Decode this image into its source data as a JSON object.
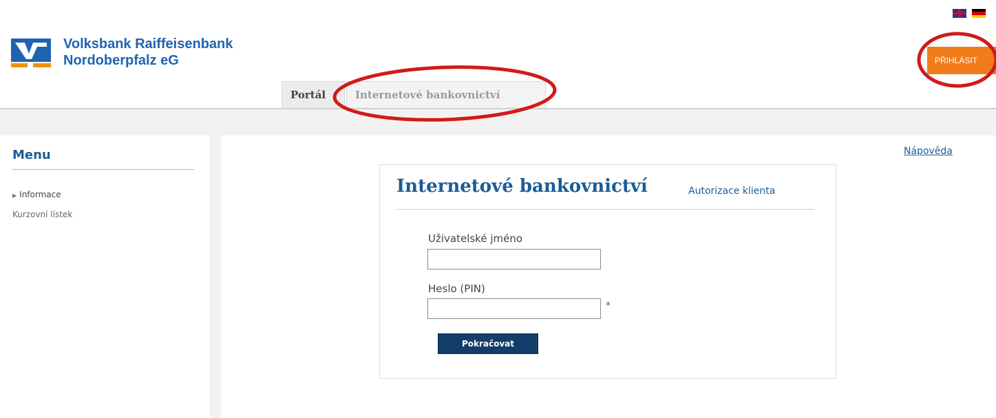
{
  "header": {
    "bank_name_line1": "Volksbank Raiffeisenbank",
    "bank_name_line2": "Nordoberpfalz eG",
    "login_button": "PŘIHLÁSIT",
    "language_flags": [
      "uk-flag-icon",
      "de-flag-icon"
    ]
  },
  "tabs": [
    {
      "label": "Portál"
    },
    {
      "label": "Internetové bankovnictví"
    }
  ],
  "sidebar": {
    "title": "Menu",
    "items": [
      {
        "label": "Informace"
      },
      {
        "label": "Kurzovní lístek"
      }
    ]
  },
  "help_link": "Nápověda",
  "login_form": {
    "title": "Internetové bankovnictví",
    "subtitle": "Autorizace klienta",
    "username_label": "Uživatelské jméno",
    "username_value": "",
    "pin_label": "Heslo (PIN)",
    "pin_value": "",
    "required_mark": "*",
    "submit_label": "Pokračovat"
  },
  "colors": {
    "brand_blue": "#1f63b0",
    "brand_orange": "#f39200",
    "login_orange": "#f07c1a",
    "submit_navy": "#153d6a",
    "annotation_red": "#d11a1a"
  }
}
